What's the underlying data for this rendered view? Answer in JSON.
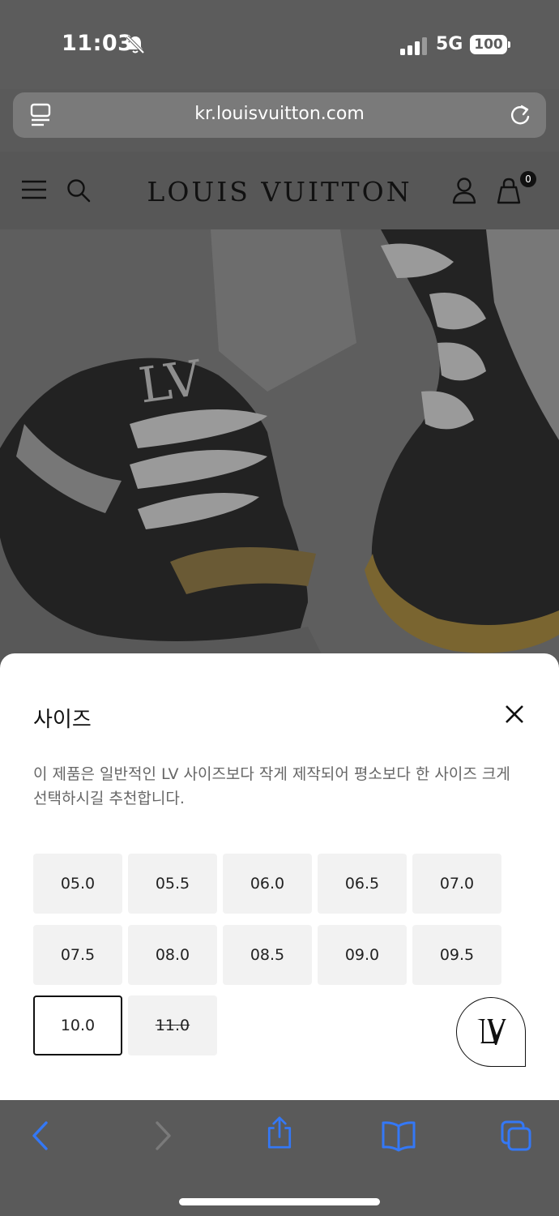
{
  "status_bar": {
    "time": "11:03",
    "network": "5G",
    "battery": "100",
    "icons": [
      "bell-slash-icon",
      "signal-icon"
    ]
  },
  "browser": {
    "url": "kr.louisvuitton.com",
    "icons": [
      "reader-icon",
      "reload-icon"
    ]
  },
  "site_header": {
    "brand": "LOUIS VUITTON",
    "cart_count": "0",
    "icons": [
      "menu-icon",
      "search-icon",
      "account-icon",
      "bag-icon"
    ]
  },
  "size_sheet": {
    "title": "사이즈",
    "description": "이 제품은 일반적인 LV 사이즈보다 작게 제작되어 평소보다 한 사이즈 크게 선택하시길 추천합니다.",
    "sizes": [
      {
        "label": "05.0",
        "state": "available"
      },
      {
        "label": "05.5",
        "state": "available"
      },
      {
        "label": "06.0",
        "state": "available"
      },
      {
        "label": "06.5",
        "state": "available"
      },
      {
        "label": "07.0",
        "state": "available"
      },
      {
        "label": "07.5",
        "state": "available"
      },
      {
        "label": "08.0",
        "state": "available"
      },
      {
        "label": "08.5",
        "state": "available"
      },
      {
        "label": "09.0",
        "state": "available"
      },
      {
        "label": "09.5",
        "state": "available"
      },
      {
        "label": "10.0",
        "state": "selected"
      },
      {
        "label": "11.0",
        "state": "sold-out"
      }
    ],
    "icons": [
      "close-icon",
      "lv-monogram-chat-icon"
    ]
  },
  "toolbar": {
    "icons": [
      "back-icon",
      "forward-icon",
      "share-icon",
      "bookmarks-icon",
      "tabs-icon"
    ],
    "accent": "#3478f6"
  }
}
